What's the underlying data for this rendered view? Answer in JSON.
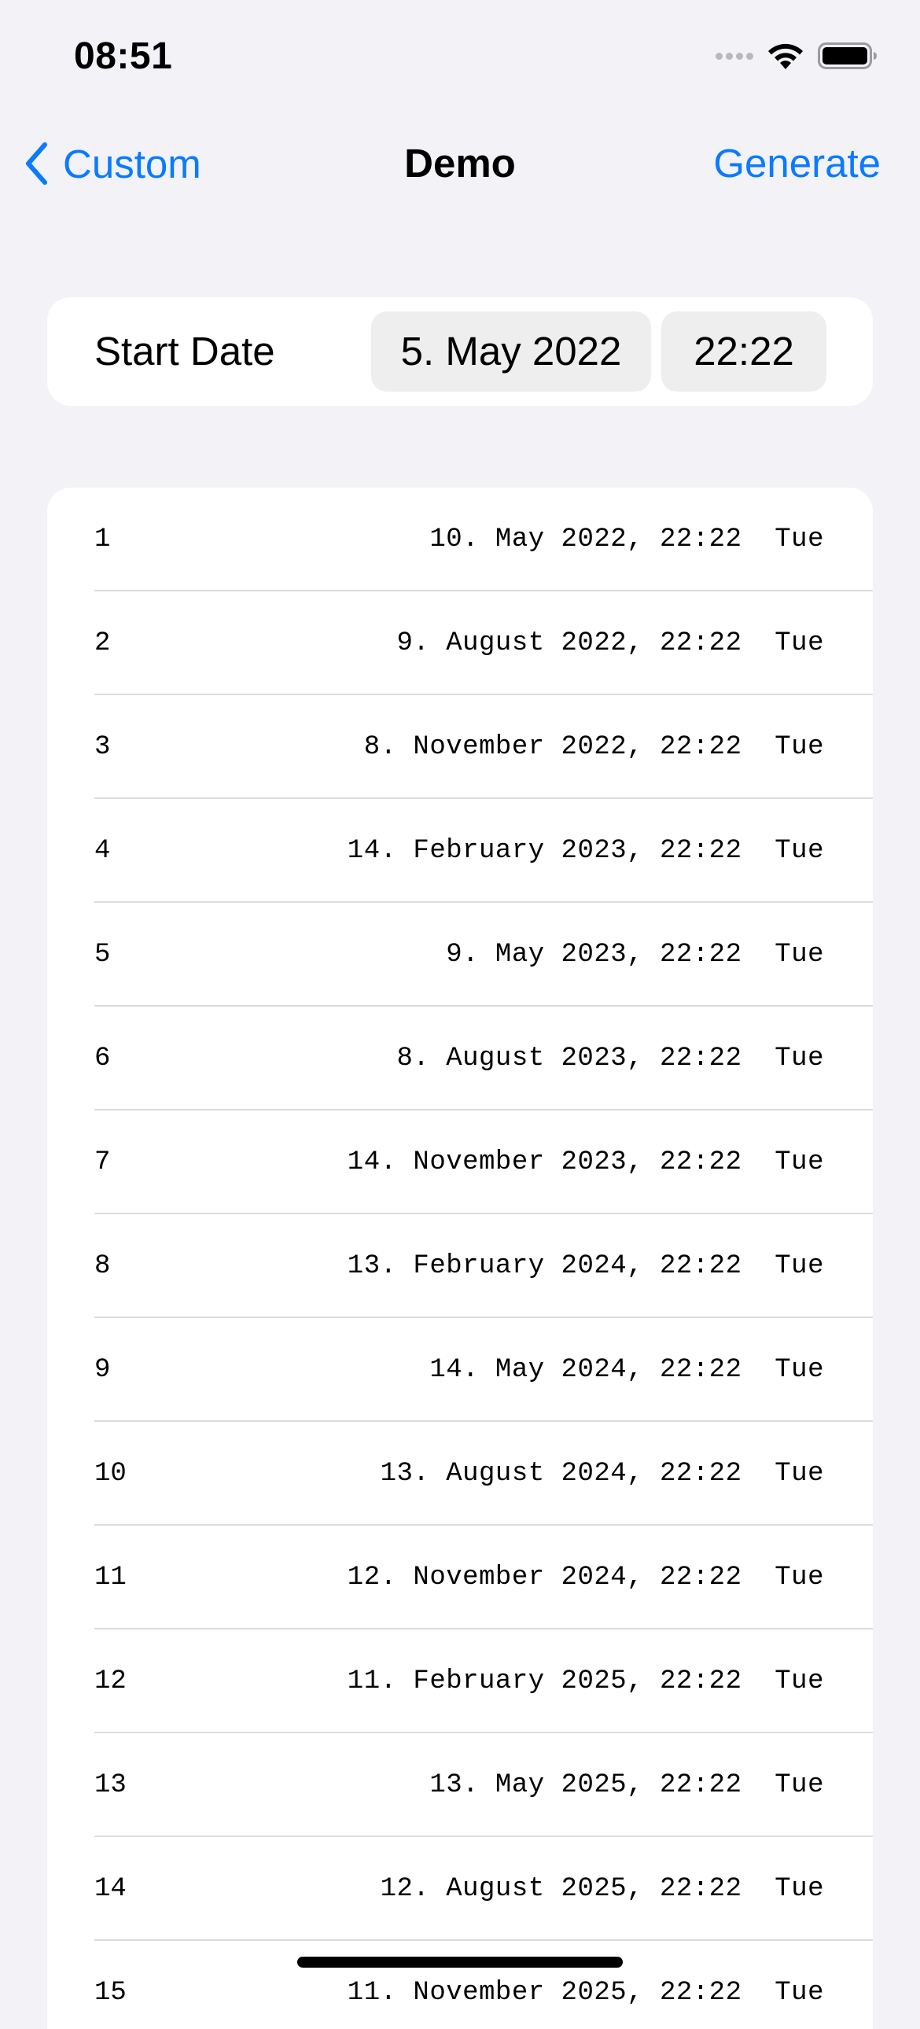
{
  "status_bar": {
    "time": "08:51",
    "icons": [
      "cellular-signal-icon",
      "wifi-icon",
      "battery-icon"
    ]
  },
  "nav": {
    "back_label": "Custom",
    "title": "Demo",
    "action_label": "Generate"
  },
  "start_date": {
    "label": "Start Date",
    "date_value": "5. May 2022",
    "time_value": "22:22"
  },
  "results": [
    {
      "index": "1",
      "value": "10. May 2022, 22:22  Tue"
    },
    {
      "index": "2",
      "value": "9. August 2022, 22:22  Tue"
    },
    {
      "index": "3",
      "value": "8. November 2022, 22:22  Tue"
    },
    {
      "index": "4",
      "value": "14. February 2023, 22:22  Tue"
    },
    {
      "index": "5",
      "value": "9. May 2023, 22:22  Tue"
    },
    {
      "index": "6",
      "value": "8. August 2023, 22:22  Tue"
    },
    {
      "index": "7",
      "value": "14. November 2023, 22:22  Tue"
    },
    {
      "index": "8",
      "value": "13. February 2024, 22:22  Tue"
    },
    {
      "index": "9",
      "value": "14. May 2024, 22:22  Tue"
    },
    {
      "index": "10",
      "value": "13. August 2024, 22:22  Tue"
    },
    {
      "index": "11",
      "value": "12. November 2024, 22:22  Tue"
    },
    {
      "index": "12",
      "value": "11. February 2025, 22:22  Tue"
    },
    {
      "index": "13",
      "value": "13. May 2025, 22:22  Tue"
    },
    {
      "index": "14",
      "value": "12. August 2025, 22:22  Tue"
    },
    {
      "index": "15",
      "value": "11. November 2025, 22:22  Tue"
    }
  ],
  "colors": {
    "accent": "#0a7aff",
    "background": "#f2f2f7",
    "card": "#ffffff",
    "pill": "#eeeeef",
    "separator": "#dcdcdf"
  }
}
